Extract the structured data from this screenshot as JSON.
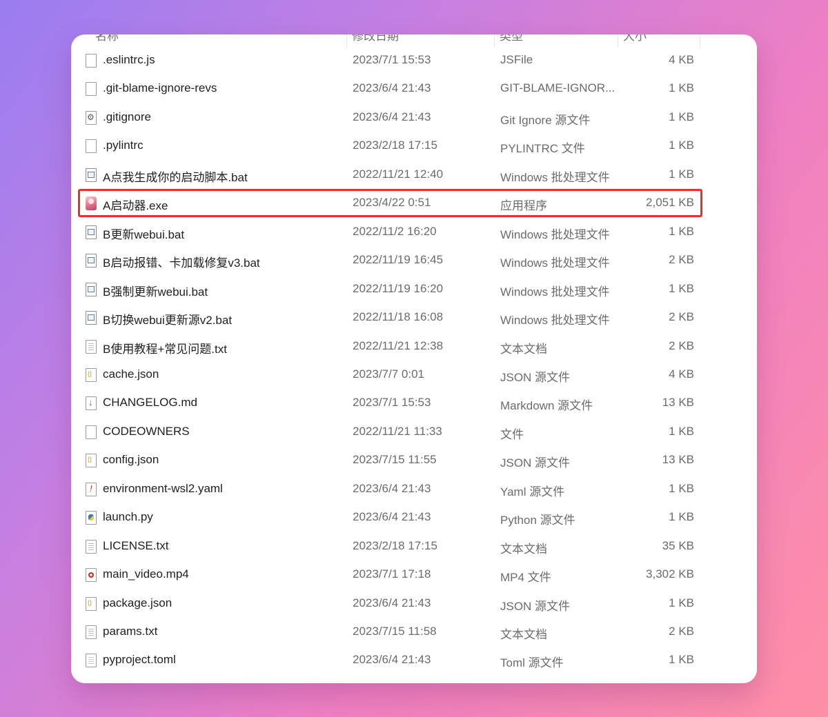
{
  "columns": {
    "name": "名称",
    "date": "修改日期",
    "type": "类型",
    "size": "大小"
  },
  "files": [
    {
      "name": ".eslintrc.js",
      "date": "2023/7/1 15:53",
      "type": "JSFile",
      "size": "4 KB",
      "icon": "blank-file-icon"
    },
    {
      "name": ".git-blame-ignore-revs",
      "date": "2023/6/4 21:43",
      "type": "GIT-BLAME-IGNOR...",
      "size": "1 KB",
      "icon": "blank-file-icon"
    },
    {
      "name": ".gitignore",
      "date": "2023/6/4 21:43",
      "type": "Git Ignore 源文件",
      "size": "1 KB",
      "icon": "gear-file-icon"
    },
    {
      "name": ".pylintrc",
      "date": "2023/2/18 17:15",
      "type": "PYLINTRC 文件",
      "size": "1 KB",
      "icon": "blank-file-icon"
    },
    {
      "name": "A点我生成你的启动脚本.bat",
      "date": "2022/11/21 12:40",
      "type": "Windows 批处理文件",
      "size": "1 KB",
      "icon": "batch-file-icon"
    },
    {
      "name": "A启动器.exe",
      "date": "2023/4/22 0:51",
      "type": "应用程序",
      "size": "2,051 KB",
      "icon": "app-exe-icon",
      "highlighted": true
    },
    {
      "name": "B更新webui.bat",
      "date": "2022/11/2 16:20",
      "type": "Windows 批处理文件",
      "size": "1 KB",
      "icon": "batch-file-icon"
    },
    {
      "name": "B启动报错、卡加载修复v3.bat",
      "date": "2022/11/19 16:45",
      "type": "Windows 批处理文件",
      "size": "2 KB",
      "icon": "batch-file-icon"
    },
    {
      "name": "B强制更新webui.bat",
      "date": "2022/11/19 16:20",
      "type": "Windows 批处理文件",
      "size": "1 KB",
      "icon": "batch-file-icon"
    },
    {
      "name": "B切换webui更新源v2.bat",
      "date": "2022/11/18 16:08",
      "type": "Windows 批处理文件",
      "size": "2 KB",
      "icon": "batch-file-icon"
    },
    {
      "name": "B使用教程+常见问题.txt",
      "date": "2022/11/21 12:38",
      "type": "文本文档",
      "size": "2 KB",
      "icon": "text-file-icon"
    },
    {
      "name": "cache.json",
      "date": "2023/7/7 0:01",
      "type": "JSON 源文件",
      "size": "4 KB",
      "icon": "json-file-icon"
    },
    {
      "name": "CHANGELOG.md",
      "date": "2023/7/1 15:53",
      "type": "Markdown 源文件",
      "size": "13 KB",
      "icon": "markdown-file-icon"
    },
    {
      "name": "CODEOWNERS",
      "date": "2022/11/21 11:33",
      "type": "文件",
      "size": "1 KB",
      "icon": "blank-file-icon"
    },
    {
      "name": "config.json",
      "date": "2023/7/15 11:55",
      "type": "JSON 源文件",
      "size": "13 KB",
      "icon": "json-file-icon"
    },
    {
      "name": "environment-wsl2.yaml",
      "date": "2023/6/4 21:43",
      "type": "Yaml 源文件",
      "size": "1 KB",
      "icon": "yaml-file-icon"
    },
    {
      "name": "launch.py",
      "date": "2023/6/4 21:43",
      "type": "Python 源文件",
      "size": "1 KB",
      "icon": "python-file-icon"
    },
    {
      "name": "LICENSE.txt",
      "date": "2023/2/18 17:15",
      "type": "文本文档",
      "size": "35 KB",
      "icon": "text-file-icon"
    },
    {
      "name": "main_video.mp4",
      "date": "2023/7/1 17:18",
      "type": "MP4 文件",
      "size": "3,302 KB",
      "icon": "video-file-icon"
    },
    {
      "name": "package.json",
      "date": "2023/6/4 21:43",
      "type": "JSON 源文件",
      "size": "1 KB",
      "icon": "json-file-icon"
    },
    {
      "name": "params.txt",
      "date": "2023/7/15 11:58",
      "type": "文本文档",
      "size": "2 KB",
      "icon": "text-file-icon"
    },
    {
      "name": "pyproject.toml",
      "date": "2023/6/4 21:43",
      "type": "Toml 源文件",
      "size": "1 KB",
      "icon": "toml-file-icon"
    }
  ],
  "colors": {
    "highlight_border": "#e5322d",
    "window_bg": "#ffffff",
    "secondary_text": "#6b6b6b"
  }
}
